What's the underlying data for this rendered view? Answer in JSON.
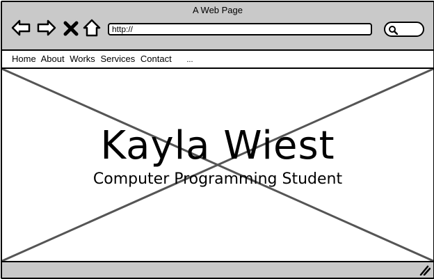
{
  "window": {
    "title": "A Web Page"
  },
  "toolbar": {
    "back_icon": "back-arrow-icon",
    "forward_icon": "forward-arrow-icon",
    "stop_icon": "close-icon",
    "home_icon": "home-icon",
    "url_value": "http://",
    "search_icon": "search-icon"
  },
  "nav": {
    "items": [
      {
        "label": "Home"
      },
      {
        "label": "About"
      },
      {
        "label": "Works"
      },
      {
        "label": "Services"
      },
      {
        "label": "Contact"
      }
    ],
    "more_label": "..."
  },
  "hero": {
    "title": "Kayla Wiest",
    "subtitle": "Computer Programming Student"
  },
  "statusbar": {
    "grip_icon": "resize-grip-icon"
  }
}
